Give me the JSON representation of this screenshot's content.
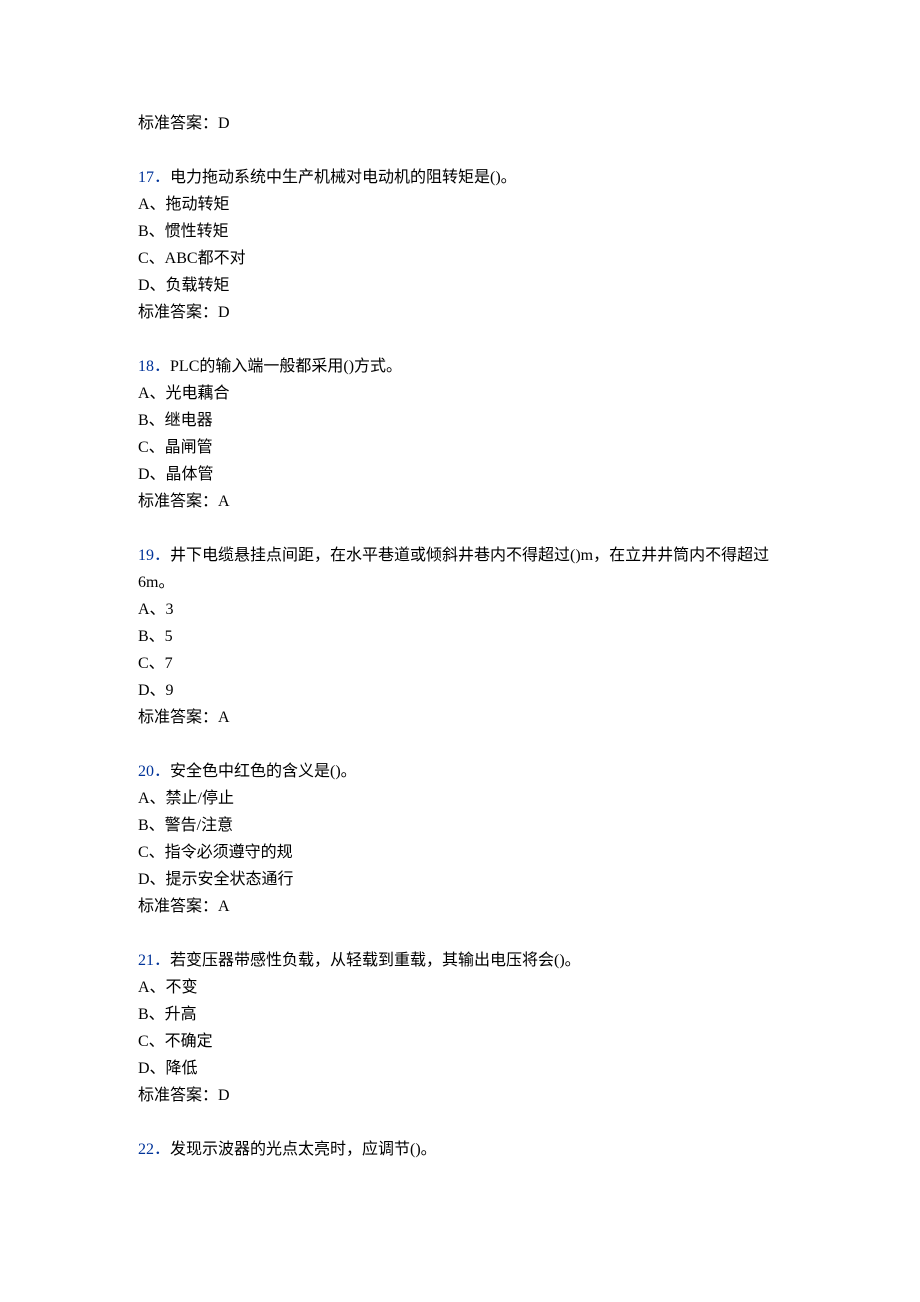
{
  "answerPrefix": "标准答案：",
  "orphanAnswer": "D",
  "questions": [
    {
      "num": "17．",
      "text": "电力拖动系统中生产机械对电动机的阻转矩是()。",
      "options": [
        "A、拖动转矩",
        "B、惯性转矩",
        "C、ABC都不对",
        "D、负载转矩"
      ],
      "answer": "D"
    },
    {
      "num": "18．",
      "text": "PLC的输入端一般都采用()方式。",
      "options": [
        "A、光电藕合",
        "B、继电器",
        "C、晶闸管",
        "D、晶体管"
      ],
      "answer": "A"
    },
    {
      "num": "19．",
      "text": "井下电缆悬挂点间距，在水平巷道或倾斜井巷内不得超过()m，在立井井筒内不得超过6m。",
      "options": [
        "A、3",
        "B、5",
        "C、7",
        "D、9"
      ],
      "answer": "A"
    },
    {
      "num": "20．",
      "text": "安全色中红色的含义是()。",
      "options": [
        "A、禁止/停止",
        "B、警告/注意",
        "C、指令必须遵守的规",
        "D、提示安全状态通行"
      ],
      "answer": "A"
    },
    {
      "num": "21．",
      "text": "若变压器带感性负载，从轻载到重载，其输出电压将会()。",
      "options": [
        "A、不变",
        "B、升高",
        "C、不确定",
        "D、降低"
      ],
      "answer": "D"
    },
    {
      "num": "22．",
      "text": "发现示波器的光点太亮时，应调节()。",
      "options": [],
      "answer": null
    }
  ]
}
